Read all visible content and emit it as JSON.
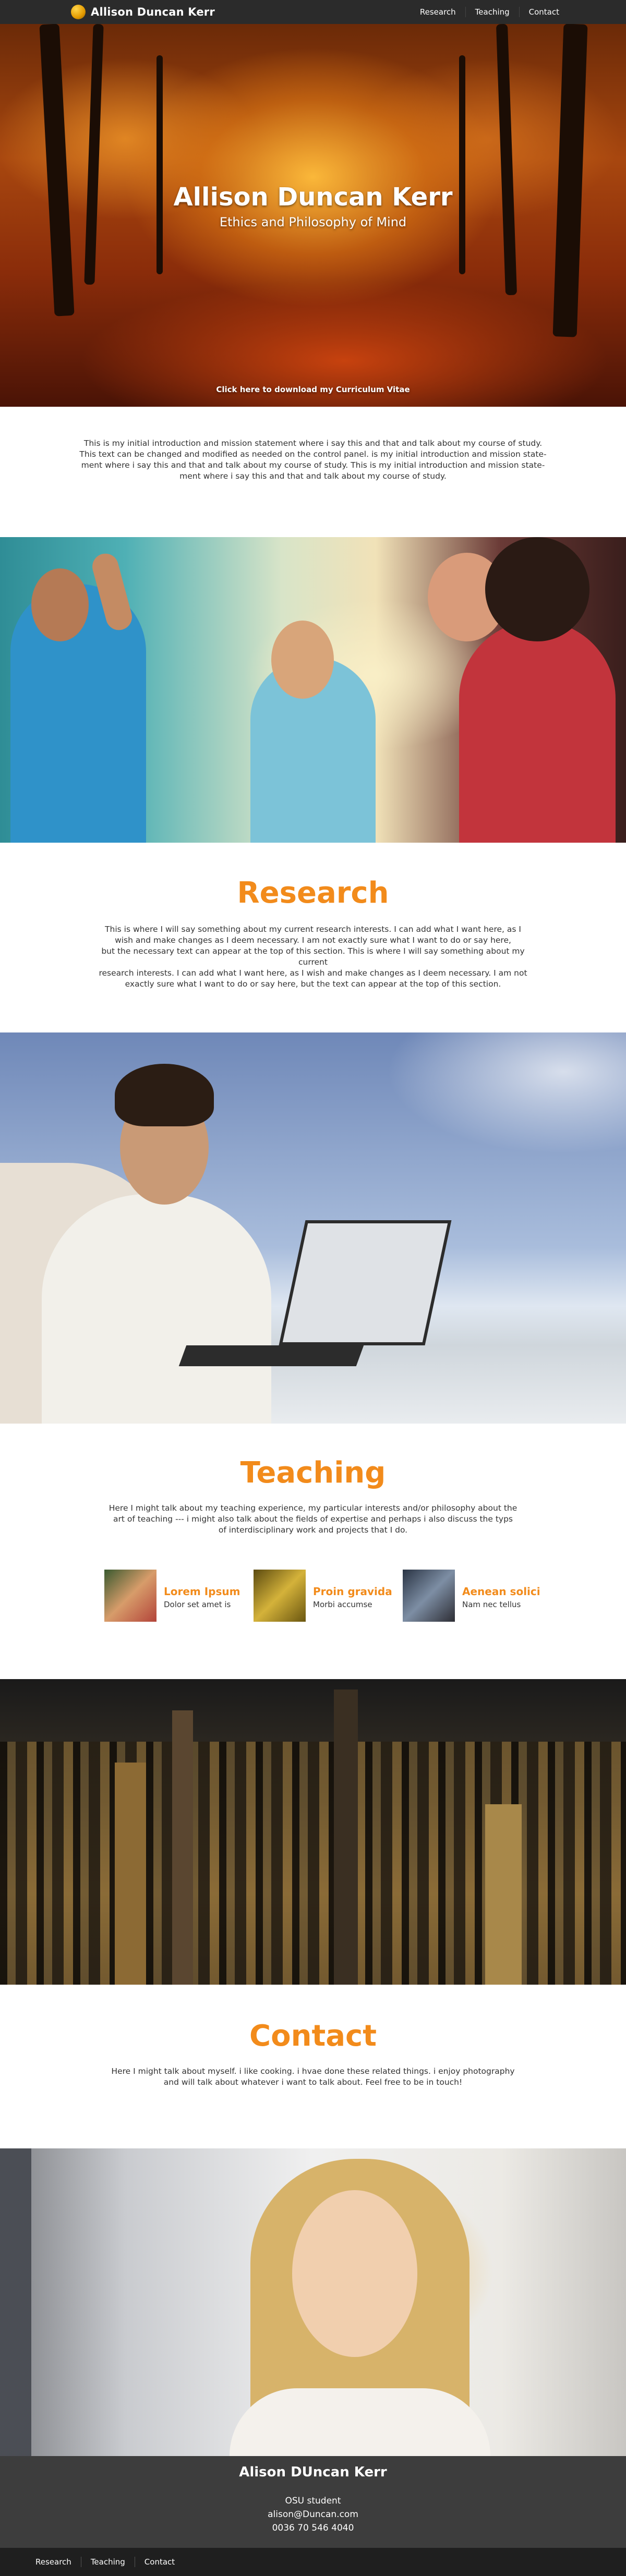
{
  "header": {
    "brand": "Allison Duncan Kerr",
    "nav": [
      "Research",
      "Teaching",
      "Contact"
    ]
  },
  "hero": {
    "title": "Allison Duncan Kerr",
    "subtitle": "Ethics and Philosophy of Mind",
    "cv_link": "Click here to download my Curriculum Vitae"
  },
  "intro": {
    "lines": [
      "This is my initial introduction and mission statement where i say this and that and talk about my course of study.",
      "This text can be changed and  modified as needed on the control panel.  is my initial introduction  and mission state-",
      "ment where i say this and that and talk about my course of study. This is my initial introduction and mission state-",
      "ment where i say this and that and talk about my course of study."
    ]
  },
  "research": {
    "title": "Research",
    "lines": [
      "This is where I will say something about my current research interests.  I can add what I want here, as I",
      "wish and make changes as I deem necessary.  I am not exactly sure what I want to do or say here,",
      "but the necessary text can appear at the top of this section.  This is where I will say something about my current",
      "research interests.  I can add what I want here, as I wish and make changes as I deem necessary.  I am not",
      "exactly sure what I want to do or say here, but the text can appear at the top of this section."
    ]
  },
  "teaching": {
    "title": "Teaching",
    "lines": [
      "Here I might talk about my teaching experience, my particular interests and/or philosophy about the",
      "art of teaching --- i might also talk about the fields of expertise and perhaps i also discuss the typs",
      "of interdisciplinary work and projects that I do."
    ],
    "items": [
      {
        "title": "Lorem Ipsum",
        "desc": "Dolor set amet is"
      },
      {
        "title": "Proin gravida",
        "desc": "Morbi accumse"
      },
      {
        "title": "Aenean solici",
        "desc": "Nam nec tellus"
      }
    ]
  },
  "contact": {
    "title": "Contact",
    "lines": [
      "Here I might talk about myself.  i like cooking.  i hvae done these related things.  i enjoy photography",
      "and will talk about whatever i want to talk about. Feel free to be in touch!"
    ]
  },
  "footer": {
    "name": "Alison DUncan Kerr",
    "role": "OSU student",
    "email": "alison@Duncan.com",
    "phone": "0036 70 546 4040",
    "nav": [
      "Research",
      "Teaching",
      "Contact"
    ]
  },
  "colors": {
    "accent": "#f28b1b",
    "topbar": "#2b2b2b",
    "footer": "#3d3d3d",
    "bottombar": "#1f1f1f"
  }
}
